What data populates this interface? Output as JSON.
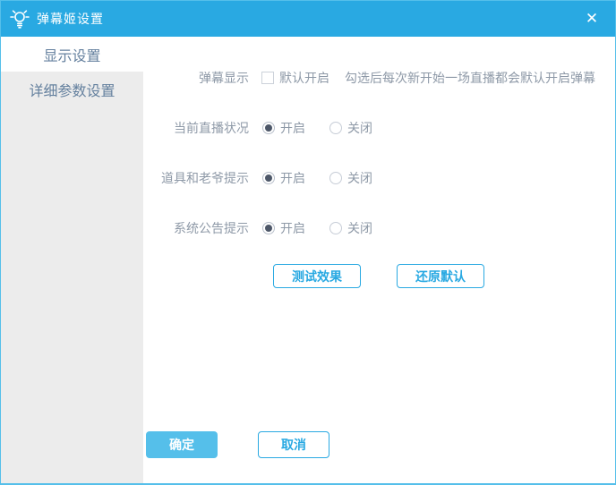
{
  "colors": {
    "accent": "#29a9e2",
    "accent_fill": "#55bfea",
    "sidebar_bg": "#ececec",
    "label_text": "#8e99a7",
    "sidebar_text": "#64809e"
  },
  "titlebar": {
    "title": "弹幕姬设置",
    "icon": "lightbulb-icon",
    "close_glyph": "✕"
  },
  "sidebar": {
    "active_index": 0,
    "items": [
      {
        "label": "显示设置"
      },
      {
        "label": "详细参数设置"
      }
    ]
  },
  "content": {
    "danmaku_row": {
      "label": "弹幕显示",
      "checkbox_label": "默认开启",
      "checkbox_state": "unchecked",
      "hint": "勾选后每次新开始一场直播都会默认开启弹幕"
    },
    "rows": [
      {
        "label": "当前直播状况",
        "on_label": "开启",
        "on_state": "selected",
        "off_label": "关闭",
        "off_state": "unselected"
      },
      {
        "label": "道具和老爷提示",
        "on_label": "开启",
        "on_state": "selected",
        "off_label": "关闭",
        "off_state": "unselected"
      },
      {
        "label": "系统公告提示",
        "on_label": "开启",
        "on_state": "selected",
        "off_label": "关闭",
        "off_state": "unselected"
      }
    ],
    "test_button": "测试效果",
    "reset_button": "还原默认"
  },
  "footer": {
    "ok": "确定",
    "cancel": "取消"
  }
}
